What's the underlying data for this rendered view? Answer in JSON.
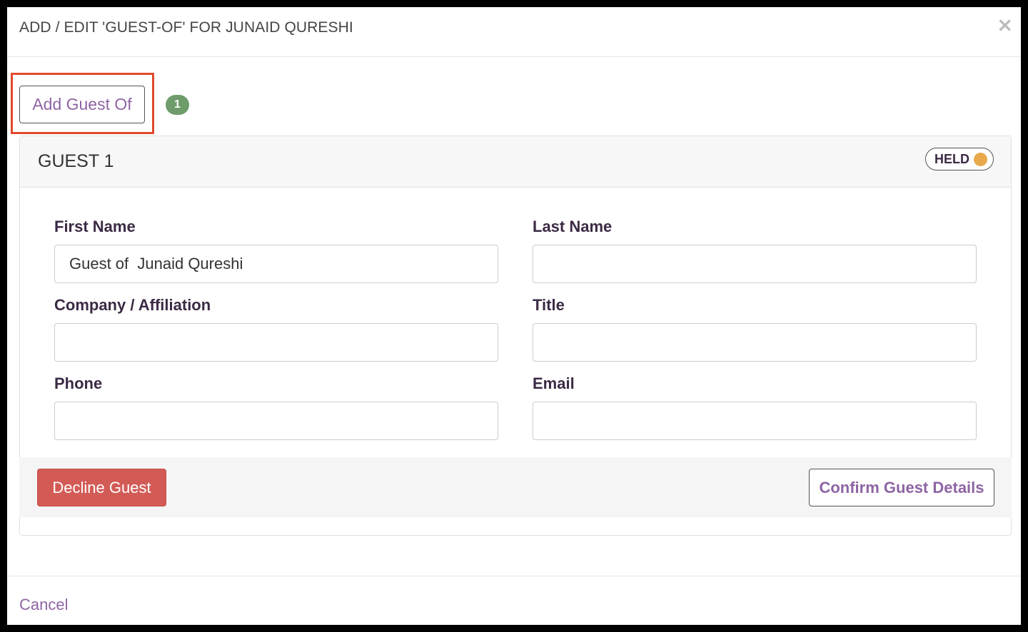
{
  "modal": {
    "title": "ADD / EDIT 'GUEST-OF' FOR JUNAID QURESHI",
    "close_icon": "close-icon",
    "cancel_label": "Cancel"
  },
  "toolbar": {
    "add_button_label": "Add Guest Of",
    "guest_count": "1"
  },
  "guest": {
    "title": "GUEST 1",
    "status_label": "HELD",
    "status_color": "#e8a94c",
    "fields": {
      "first_name": {
        "label": "First Name",
        "value": "Guest of  Junaid Qureshi",
        "placeholder": ""
      },
      "last_name": {
        "label": "Last Name",
        "value": "",
        "placeholder": ""
      },
      "company": {
        "label": "Company / Affiliation",
        "value": "",
        "placeholder": ""
      },
      "title": {
        "label": "Title",
        "value": "",
        "placeholder": ""
      },
      "phone": {
        "label": "Phone",
        "value": "",
        "placeholder": ""
      },
      "email": {
        "label": "Email",
        "value": "",
        "placeholder": ""
      }
    },
    "decline_label": "Decline Guest",
    "confirm_label": "Confirm Guest Details"
  },
  "colors": {
    "accent": "#8e64a3",
    "danger": "#d35b56",
    "badge": "#6e9c6b",
    "highlight": "#e04a2c"
  }
}
